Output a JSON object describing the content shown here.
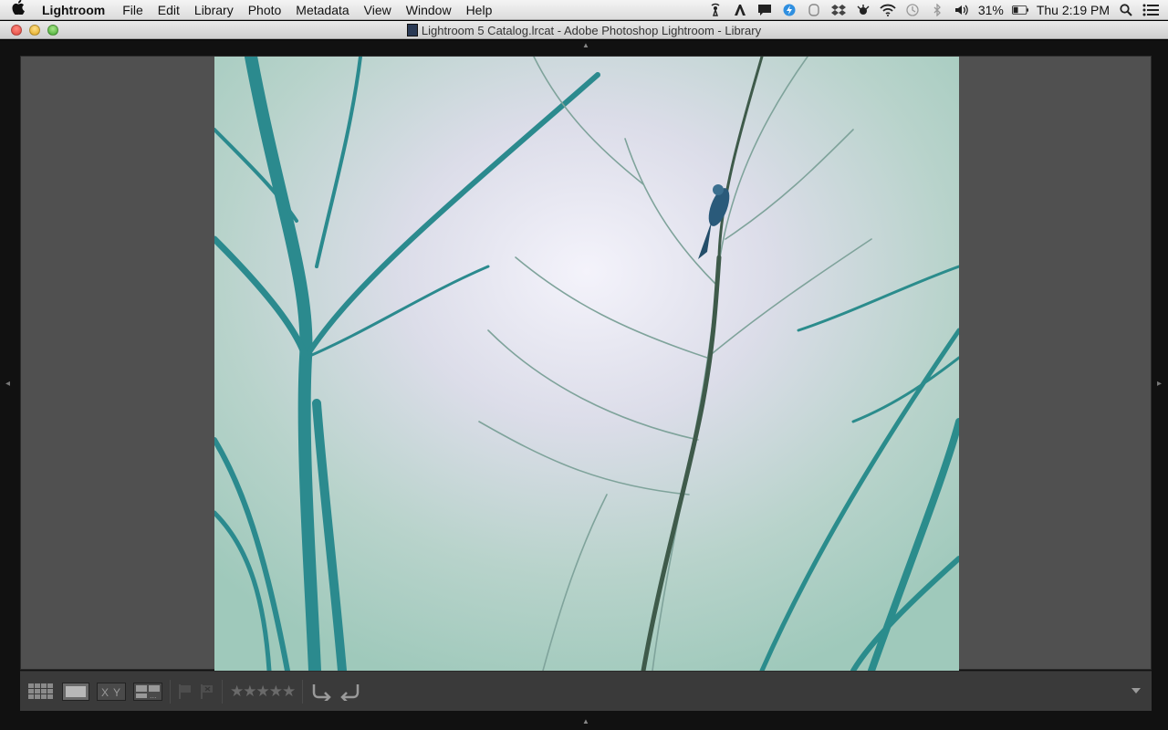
{
  "menubar": {
    "app_name": "Lightroom",
    "menus": [
      "File",
      "Edit",
      "Library",
      "Photo",
      "Metadata",
      "View",
      "Window",
      "Help"
    ],
    "battery": "31%",
    "clock": "Thu 2:19 PM"
  },
  "window": {
    "title": "Lightroom 5 Catalog.lrcat - Adobe Photoshop Lightroom - Library"
  },
  "toolbar": {
    "rating_stars": "★★★★★"
  },
  "icons": {
    "apple": "apple-icon",
    "wifi": "wifi-icon",
    "volume": "volume-icon",
    "bluetooth": "bluetooth-icon",
    "search": "spotlight-search-icon",
    "notifications": "notification-center-icon"
  },
  "colors": {
    "viewer_bg": "#505050",
    "toolbar_bg": "#3a3a3a",
    "photo_teal": "#2b8c8c",
    "photo_mist": "#e8e8f2"
  }
}
